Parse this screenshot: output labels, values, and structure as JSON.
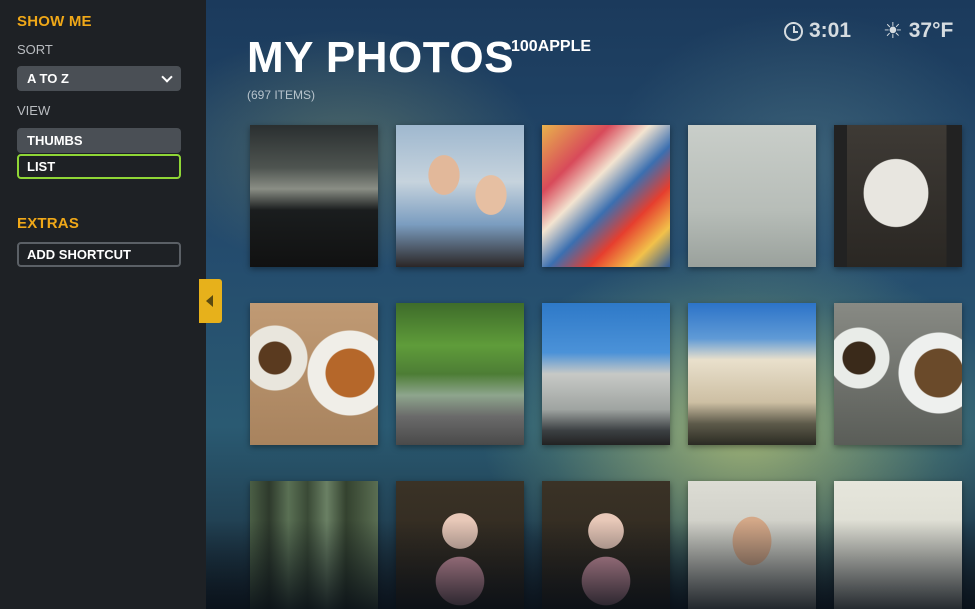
{
  "sidebar": {
    "show_me_heading": "SHOW ME",
    "sort_label": "SORT",
    "sort_value": "A TO Z",
    "view_label": "VIEW",
    "view_options": [
      "THUMBS",
      "LIST"
    ],
    "extras_heading": "EXTRAS",
    "add_shortcut_label": "ADD SHORTCUT"
  },
  "header": {
    "title": "MY PHOTOS",
    "folder": "100APPLE",
    "item_count": "(697 ITEMS)"
  },
  "status": {
    "time": "3:01",
    "temperature": "37°F",
    "clock_icon": "clock-icon",
    "weather_icon": "sun-icon"
  },
  "colors": {
    "accent": "#f0a818",
    "focus": "#8fd636",
    "sidebar_bg": "#1e2125"
  },
  "photos": [
    {
      "name": "photo-cabin-interior"
    },
    {
      "name": "photo-couple-selfie"
    },
    {
      "name": "photo-magazine-collage"
    },
    {
      "name": "photo-desk-sketch"
    },
    {
      "name": "photo-bar-for-sale-sign"
    },
    {
      "name": "photo-coffee-and-pastry"
    },
    {
      "name": "photo-tree-lined-street"
    },
    {
      "name": "photo-white-house"
    },
    {
      "name": "photo-victorian-balcony"
    },
    {
      "name": "photo-coffee-cup-plate"
    },
    {
      "name": "photo-forest-figure"
    },
    {
      "name": "photo-doll-flowers"
    },
    {
      "name": "photo-doll-flowers-2"
    },
    {
      "name": "photo-man-sunglasses"
    },
    {
      "name": "photo-white-wall"
    }
  ]
}
